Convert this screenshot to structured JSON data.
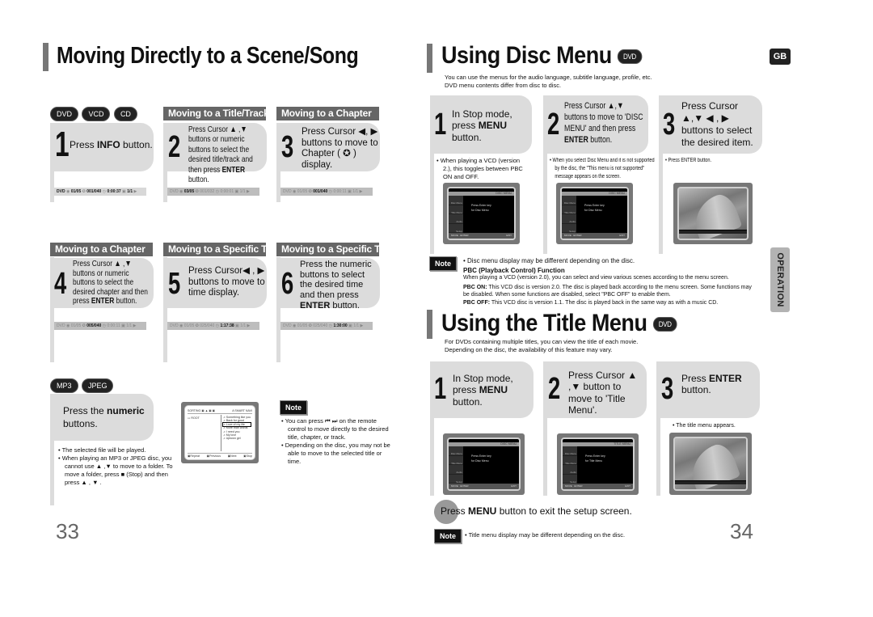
{
  "left_page": {
    "title": "Moving Directly to a Scene/Song",
    "disc_badges": [
      "DVD",
      "VCD",
      "CD"
    ],
    "sections": [
      {
        "header": "",
        "step": "1",
        "text_parts": [
          "Press ",
          "INFO",
          " button."
        ],
        "info": {
          "lead": "DVD",
          "title": "01/05",
          "chapter": "001/040",
          "time": "0:00:37",
          "audio": "1/1"
        }
      },
      {
        "header": "Moving to a Title/Track",
        "step": "2",
        "text_parts": [
          "Press Cursor ▲ ,▼ buttons or numeric buttons to select the desired title/track and then press ",
          "ENTER",
          " button."
        ],
        "info": {
          "lead": "DVD",
          "title": "03/05",
          "chapter": "001/032",
          "time": "0:00:01",
          "audio": "1/1"
        }
      },
      {
        "header": "Moving to a Chapter",
        "step": "3",
        "text_parts": [
          "Press Cursor ◀, ▶ buttons to move to Chapter ( ",
          "✪",
          " ) display."
        ],
        "info": {
          "lead": "DVD",
          "title": "01/05",
          "chapter": "001/040",
          "time": "0:00:11",
          "audio": "1/1"
        }
      },
      {
        "header": "Moving to a Chapter",
        "step": "4",
        "text_parts": [
          "Press Cursor ▲ ,▼ buttons or numeric buttons to select the desired chapter and then press ",
          "ENTER",
          " button."
        ],
        "info": {
          "lead": "DVD",
          "title": "01/05",
          "chapter": "005/040",
          "time": "0:00:11",
          "audio": "1/1"
        }
      },
      {
        "header": "Moving to a Specific Time",
        "step": "5",
        "text_parts": [
          "Press Cursor◀ , ▶ buttons to move to time display.",
          "",
          ""
        ],
        "info": {
          "lead": "DVD",
          "title": "01/05",
          "chapter": "025/040",
          "time": "1:17:38",
          "audio": "1/1"
        }
      },
      {
        "header": "Moving to a Specific Time",
        "step": "6",
        "text_parts": [
          "Press the numeric buttons to select the desired time and then press ",
          "ENTER",
          " button."
        ],
        "info": {
          "lead": "DVD",
          "title": "01/05",
          "chapter": "025/040",
          "time": "1:30:00",
          "audio": "1/1"
        }
      }
    ],
    "mp3_badges": [
      "MP3",
      "JPEG"
    ],
    "mp3_step": {
      "text_plain": "Press the ",
      "text_bold": "numeric",
      "text_end": " buttons."
    },
    "mp3_bullets": [
      "The selected file will be played.",
      "When playing an MP3 or JPEG disc, you cannot use ▲ ,▼ to move to a folder. To move a folder, press ■ (Stop) and then press ▲ , ▼ ."
    ],
    "mp3_screen": {
      "header": "SORTING",
      "header_right": "A SMART NAVI",
      "folder": "ROOT",
      "tracks": [
        "Something like you",
        "Back for good",
        "Love of my life",
        "More than words",
        "I need you",
        "My love",
        "Uptown girl"
      ],
      "selected_track_index": 2,
      "footer": [
        "Repeat",
        "Previous",
        "Next",
        "Stop"
      ]
    },
    "note_label": "Note",
    "note_bullets": [
      "You can press ⏮ ⏭ on the remote control to move directly to the desired title, chapter, or track.",
      "Depending on the disc, you may not be able to move to the selected title or time."
    ],
    "page_number": "33"
  },
  "right_page": {
    "lang_badge": "GB",
    "side_tab": "OPERATION",
    "disc_menu": {
      "title": "Using Disc Menu",
      "badge": "DVD",
      "intro": [
        "You can use the menus for the audio language, subtitle language, profile, etc.",
        "DVD menu contents differ from disc to disc."
      ],
      "steps": [
        {
          "step": "1",
          "text_parts": [
            "In Stop mode, press ",
            "MENU",
            " button."
          ],
          "bullet": "When playing a VCD (version 2.), this toggles between PBC ON and OFF."
        },
        {
          "step": "2",
          "text_parts": [
            "Press Cursor ▲,▼ buttons to move to 'DISC MENU' and then press ",
            "ENTER",
            " button."
          ],
          "bullet": "When you select Disc Menu and it is not supported by the disc, the \"This menu is not supported\" message appears on the screen."
        },
        {
          "step": "3",
          "text_parts": [
            "Press Cursor ▲,▼ ◀ , ▶ buttons to select the desired item.",
            "",
            ""
          ],
          "bullet": "Press ENTER button."
        }
      ],
      "screens": [
        {
          "tab": "DISC MENU",
          "side": [
            "Disc Menu",
            "Title Menu",
            "Audio",
            "Setup"
          ],
          "msg": [
            "Press Enter key",
            "for Disc Menu"
          ],
          "foot": [
            "MOVE",
            "ENTER",
            "EXIT"
          ]
        },
        {
          "tab": "DISC MENU",
          "side": [
            "Disc Menu",
            "Title Menu",
            "Audio",
            "Setup"
          ],
          "msg": [
            "Press Enter key",
            "for Disc Menu"
          ],
          "foot": [
            "MOVE",
            "ENTER",
            "EXIT"
          ]
        }
      ],
      "note_label": "Note",
      "note_text": "Disc menu display may be different depending on the disc.",
      "pbc_title": "PBC (Playback Control) Function",
      "pbc_intro": "When playing a VCD (version 2.0), you can select and view various scenes according to the menu screen.",
      "pbc_on_label": "PBC ON:",
      "pbc_on_text": "This VCD disc is version 2.0. The disc is played back according to the menu screen. Some functions may be disabled. When some functions are disabled, select \"PBC OFF\" to enable them.",
      "pbc_off_label": "PBC OFF:",
      "pbc_off_text": "This VCD disc is version 1.1. The disc is played back in the same way as with a music CD."
    },
    "title_menu": {
      "title": "Using the Title Menu",
      "badge": "DVD",
      "intro": [
        "For DVDs containing multiple titles, you can view the title of each movie.",
        "Depending on the disc, the availability of this feature may vary."
      ],
      "steps": [
        {
          "step": "1",
          "text_parts": [
            "In Stop mode, press ",
            "MENU",
            " button."
          ],
          "bullet": ""
        },
        {
          "step": "2",
          "text_parts": [
            "Press Cursor ▲ ,▼ button to move to 'Title Menu'.",
            "",
            ""
          ],
          "bullet": ""
        },
        {
          "step": "3",
          "text_parts": [
            "Press ",
            "ENTER",
            " button."
          ],
          "bullet": "The title menu appears."
        }
      ],
      "screens": [
        {
          "tab": "DISC MENU",
          "side": [
            "Disc Menu",
            "Title Menu",
            "Audio",
            "Setup"
          ],
          "msg": [
            "Press Enter key",
            "for Disc Menu"
          ],
          "foot": [
            "MOVE",
            "ENTER",
            "EXIT"
          ]
        },
        {
          "tab": "TITLE MENU",
          "side": [
            "Disc Menu",
            "Title Menu",
            "Audio",
            "Setup"
          ],
          "msg": [
            "Press Enter key",
            "for Title Menu"
          ],
          "foot": [
            "MOVE",
            "ENTER",
            "EXIT"
          ]
        }
      ],
      "exit_text_parts": [
        "Press ",
        "MENU",
        " button to exit the setup screen."
      ],
      "note_label": "Note",
      "note_text": "Title menu display may be different depending on the disc."
    },
    "page_number": "34"
  }
}
